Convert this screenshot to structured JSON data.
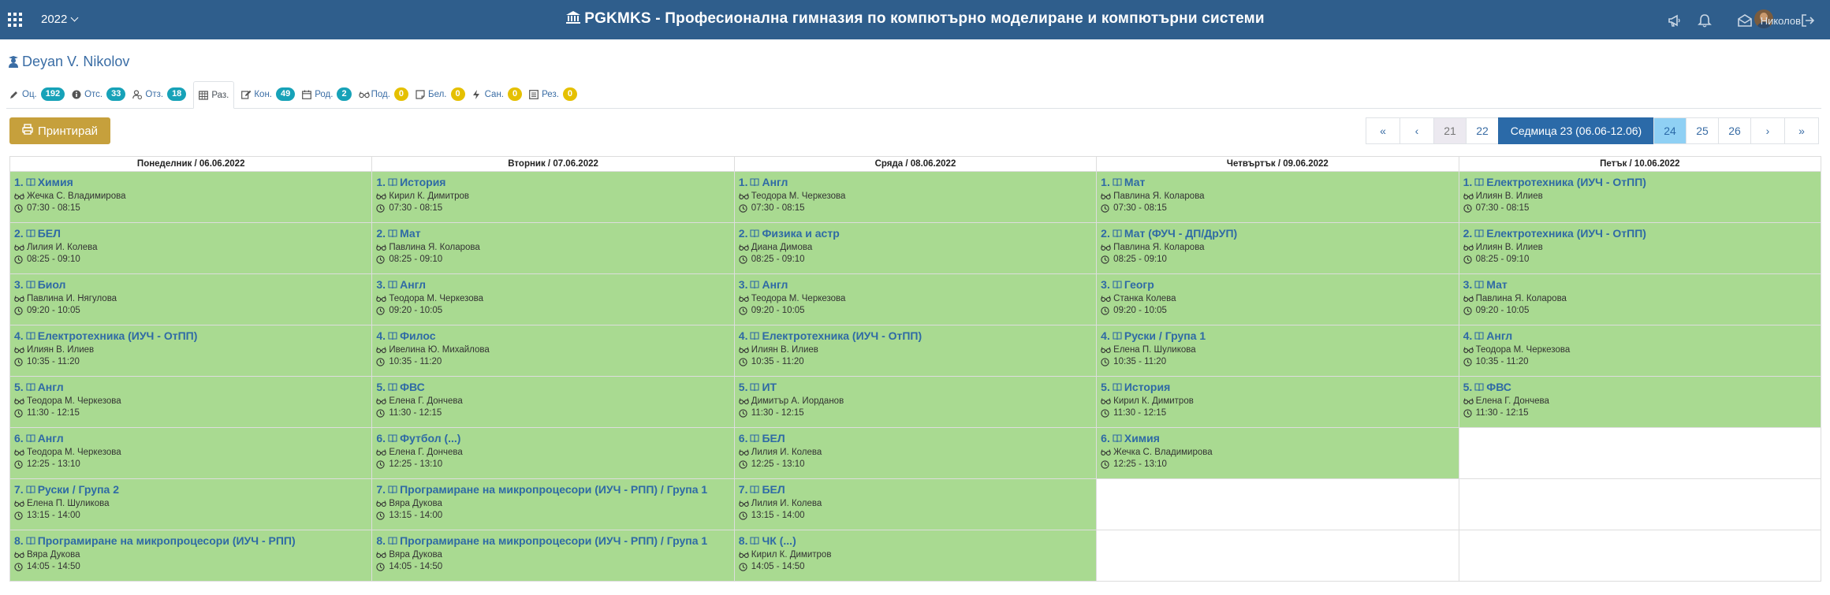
{
  "header": {
    "year": "2022",
    "title": "PGKMKS - Професионална гимназия по компютърно моделиране и компютърни системи",
    "user_name": "Николов",
    "icons": [
      "apps-grid-icon",
      "megaphone-icon",
      "bell-icon",
      "envelope-open-icon",
      "logout-icon"
    ]
  },
  "student": {
    "name": "Deyan V. Nikolov",
    "icon": "user-graduate-icon"
  },
  "tabs": [
    {
      "label": "Оц.",
      "icon": "pencil-icon",
      "count": "192",
      "color": "teal"
    },
    {
      "label": "Отс.",
      "icon": "info-circle-icon",
      "count": "33",
      "color": "teal"
    },
    {
      "label": "Отз.",
      "icon": "user-clock-icon",
      "count": "18",
      "color": "teal"
    },
    {
      "label": "Раз.",
      "icon": "table-icon",
      "count": "",
      "color": ""
    },
    {
      "label": "Кон.",
      "icon": "edit-icon",
      "count": "49",
      "color": "teal"
    },
    {
      "label": "Род.",
      "icon": "calendar-icon",
      "count": "2",
      "color": "teal"
    },
    {
      "label": "Под.",
      "icon": "glasses-icon",
      "count": "0",
      "color": "yellow"
    },
    {
      "label": "Бел.",
      "icon": "note-icon",
      "count": "0",
      "color": "yellow"
    },
    {
      "label": "Сан.",
      "icon": "bolt-icon",
      "count": "0",
      "color": "yellow"
    },
    {
      "label": "Рез.",
      "icon": "list-alt-icon",
      "count": "0",
      "color": "yellow"
    }
  ],
  "print_button": {
    "label": "Принтирай",
    "icon": "print-icon"
  },
  "pagination": {
    "first": "«",
    "prev": "‹",
    "weeks_before": [
      "21",
      "22"
    ],
    "current": "Седмица 23 (06.06-12.06)",
    "weeks_after": [
      "24",
      "25",
      "26"
    ],
    "next": "›",
    "last": "»"
  },
  "schedule": {
    "days": [
      "Понеделник / 06.06.2022",
      "Вторник / 07.06.2022",
      "Сряда / 08.06.2022",
      "Четвъртък / 09.06.2022",
      "Петък / 10.06.2022"
    ],
    "rows": [
      [
        {
          "n": "1.",
          "subject": "Химия",
          "teacher": "Жечка С. Владимирова",
          "time": "07:30 - 08:15"
        },
        {
          "n": "1.",
          "subject": "История",
          "teacher": "Кирил К. Димитров",
          "time": "07:30 - 08:15"
        },
        {
          "n": "1.",
          "subject": "Англ",
          "teacher": "Теодора М. Черкезова",
          "time": "07:30 - 08:15"
        },
        {
          "n": "1.",
          "subject": "Мат",
          "teacher": "Павлина Я. Коларова",
          "time": "07:30 - 08:15"
        },
        {
          "n": "1.",
          "subject": "Електротехника (ИУЧ - ОтПП)",
          "teacher": "Илиян В. Илиев",
          "time": "07:30 - 08:15"
        }
      ],
      [
        {
          "n": "2.",
          "subject": "БЕЛ",
          "teacher": "Лилия Й. Колева",
          "time": "08:25 - 09:10"
        },
        {
          "n": "2.",
          "subject": "Мат",
          "teacher": "Павлина Я. Коларова",
          "time": "08:25 - 09:10"
        },
        {
          "n": "2.",
          "subject": "Физика и астр",
          "teacher": "Диана Димова",
          "time": "08:25 - 09:10"
        },
        {
          "n": "2.",
          "subject": "Мат (ФУЧ - ДП/ДрУП)",
          "teacher": "Павлина Я. Коларова",
          "time": "08:25 - 09:10"
        },
        {
          "n": "2.",
          "subject": "Електротехника (ИУЧ - ОтПП)",
          "teacher": "Илиян В. Илиев",
          "time": "08:25 - 09:10"
        }
      ],
      [
        {
          "n": "3.",
          "subject": "Биол",
          "teacher": "Павлина Й. Нягулова",
          "time": "09:20 - 10:05"
        },
        {
          "n": "3.",
          "subject": "Англ",
          "teacher": "Теодора М. Черкезова",
          "time": "09:20 - 10:05"
        },
        {
          "n": "3.",
          "subject": "Англ",
          "teacher": "Теодора М. Черкезова",
          "time": "09:20 - 10:05"
        },
        {
          "n": "3.",
          "subject": "Геогр",
          "teacher": "Станка Колева",
          "time": "09:20 - 10:05"
        },
        {
          "n": "3.",
          "subject": "Мат",
          "teacher": "Павлина Я. Коларова",
          "time": "09:20 - 10:05"
        }
      ],
      [
        {
          "n": "4.",
          "subject": "Електротехника (ИУЧ - ОтПП)",
          "teacher": "Илиян В. Илиев",
          "time": "10:35 - 11:20"
        },
        {
          "n": "4.",
          "subject": "Филос",
          "teacher": "Ивелина Ю. Михайлова",
          "time": "10:35 - 11:20"
        },
        {
          "n": "4.",
          "subject": "Електротехника (ИУЧ - ОтПП)",
          "teacher": "Илиян В. Илиев",
          "time": "10:35 - 11:20"
        },
        {
          "n": "4.",
          "subject": "Руски / Група 1",
          "teacher": "Елена П. Шуликова",
          "time": "10:35 - 11:20"
        },
        {
          "n": "4.",
          "subject": "Англ",
          "teacher": "Теодора М. Черкезова",
          "time": "10:35 - 11:20"
        }
      ],
      [
        {
          "n": "5.",
          "subject": "Англ",
          "teacher": "Теодора М. Черкезова",
          "time": "11:30 - 12:15"
        },
        {
          "n": "5.",
          "subject": "ФВС",
          "teacher": "Елена Г. Дончева",
          "time": "11:30 - 12:15"
        },
        {
          "n": "5.",
          "subject": "ИТ",
          "teacher": "Димитър А. Йорданов",
          "time": "11:30 - 12:15"
        },
        {
          "n": "5.",
          "subject": "История",
          "teacher": "Кирил К. Димитров",
          "time": "11:30 - 12:15"
        },
        {
          "n": "5.",
          "subject": "ФВС",
          "teacher": "Елена Г. Дончева",
          "time": "11:30 - 12:15"
        }
      ],
      [
        {
          "n": "6.",
          "subject": "Англ",
          "teacher": "Теодора М. Черкезова",
          "time": "12:25 - 13:10"
        },
        {
          "n": "6.",
          "subject": "Футбол (...)",
          "teacher": "Елена Г. Дончева",
          "time": "12:25 - 13:10"
        },
        {
          "n": "6.",
          "subject": "БЕЛ",
          "teacher": "Лилия Й. Колева",
          "time": "12:25 - 13:10"
        },
        {
          "n": "6.",
          "subject": "Химия",
          "teacher": "Жечка С. Владимирова",
          "time": "12:25 - 13:10"
        },
        null
      ],
      [
        {
          "n": "7.",
          "subject": "Руски / Група 2",
          "teacher": "Елена П. Шуликова",
          "time": "13:15 - 14:00"
        },
        {
          "n": "7.",
          "subject": "Програмиране на микропроцесори (ИУЧ - РПП) / Група 1",
          "teacher": "Вяра Дукова",
          "time": "13:15 - 14:00"
        },
        {
          "n": "7.",
          "subject": "БЕЛ",
          "teacher": "Лилия Й. Колева",
          "time": "13:15 - 14:00"
        },
        null,
        null
      ],
      [
        {
          "n": "8.",
          "subject": "Програмиране на микропроцесори (ИУЧ - РПП)",
          "teacher": "Вяра Дукова",
          "time": "14:05 - 14:50"
        },
        {
          "n": "8.",
          "subject": "Програмиране на микропроцесори (ИУЧ - РПП) / Група 1",
          "teacher": "Вяра Дукова",
          "time": "14:05 - 14:50"
        },
        {
          "n": "8.",
          "subject": "ЧК (...)",
          "teacher": "Кирил К. Димитров",
          "time": "14:05 - 14:50"
        },
        null,
        null
      ]
    ]
  },
  "colors": {
    "header_bg": "#2f5e8c",
    "cell_bg": "#a9da91",
    "link": "#2f6aa5",
    "print_btn": "#c6a03c",
    "pager_active": "#2b6aa8",
    "pager_highlight": "#8fd0f4",
    "badge_teal": "#17a2b8",
    "badge_yellow": "#e5c000"
  }
}
